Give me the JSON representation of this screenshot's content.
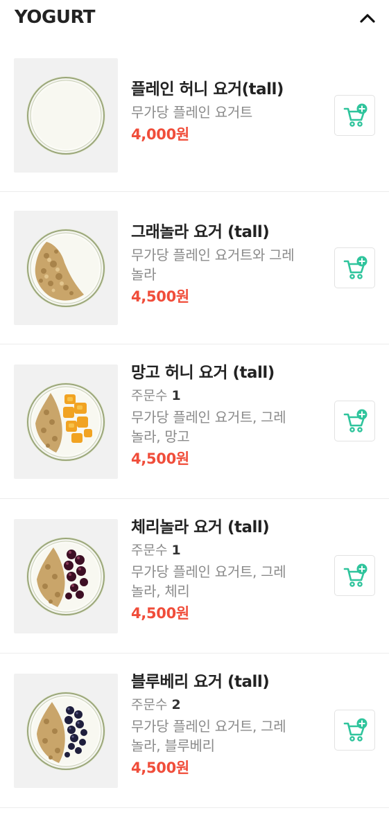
{
  "section": {
    "title": "YOGURT",
    "toggle_icon": "chevron-up-icon"
  },
  "colors": {
    "price": "#f04d3a",
    "cart_icon": "#2fc49c",
    "thumb_bg": "#f1f1f1"
  },
  "items": [
    {
      "name": "플레인 허니 요거(tall)",
      "orders_label": "",
      "orders_count": "",
      "desc_line1": "무가당 플레인 요거트",
      "desc_line2": "",
      "price": "4,000원",
      "image_icon": "plain-yogurt-image"
    },
    {
      "name": "그래놀라 요거 (tall)",
      "orders_label": "",
      "orders_count": "",
      "desc_line1": "무가당 플레인 요거트와 그레",
      "desc_line2": "놀라",
      "price": "4,500원",
      "image_icon": "granola-yogurt-image"
    },
    {
      "name": "망고 허니 요거 (tall)",
      "orders_label": "주문수",
      "orders_count": "1",
      "desc_line1": "무가당 플레인 요거트, 그레",
      "desc_line2": "놀라, 망고",
      "price": "4,500원",
      "image_icon": "mango-yogurt-image"
    },
    {
      "name": "체리놀라 요거 (tall)",
      "orders_label": "주문수",
      "orders_count": "1",
      "desc_line1": "무가당 플레인 요거트, 그레",
      "desc_line2": "놀라, 체리",
      "price": "4,500원",
      "image_icon": "cherry-yogurt-image"
    },
    {
      "name": "블루베리 요거 (tall)",
      "orders_label": "주문수",
      "orders_count": "2",
      "desc_line1": "무가당 플레인 요거트, 그레",
      "desc_line2": "놀라, 블루베리",
      "price": "4,500원",
      "image_icon": "blueberry-yogurt-image"
    }
  ]
}
